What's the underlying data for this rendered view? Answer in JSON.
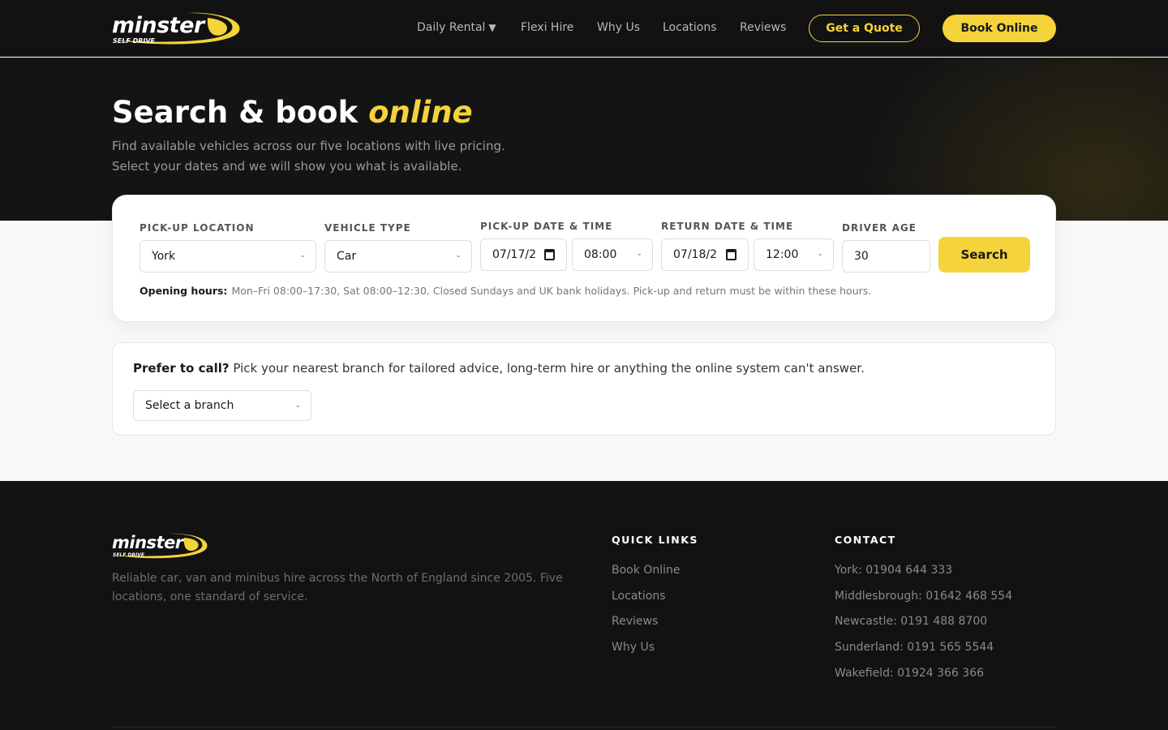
{
  "brand": {
    "logo_word": "minster",
    "logo_sub": "SELF DRIVE",
    "accent_color": "#f5d33a"
  },
  "nav": {
    "items": [
      {
        "label": "Daily Rental",
        "caret": "▼"
      },
      {
        "label": "Flexi Hire"
      },
      {
        "label": "Why Us"
      },
      {
        "label": "Locations"
      },
      {
        "label": "Reviews"
      }
    ],
    "quote_label": "Get a Quote",
    "book_label": "Book Online"
  },
  "hero": {
    "title": "Search & book",
    "title_accent": "online",
    "subtitle_line1": "Find available vehicles across our five locations with live pricing.",
    "subtitle_line2": "Select your dates and we will show you what is available."
  },
  "search": {
    "pickup_location_label": "PICK-UP LOCATION",
    "pickup_location_value": "York",
    "vehicle_type_label": "VEHICLE TYPE",
    "vehicle_type_value": "Car",
    "pickup_datetime_label": "PICK-UP DATE & TIME",
    "pickup_date_value": "07/17/2",
    "pickup_time_value": "08:00",
    "return_datetime_label": "RETURN DATE & TIME",
    "return_date_value": "07/18/2",
    "return_time_value": "12:00",
    "driver_age_label": "DRIVER AGE",
    "driver_age_value": "30",
    "search_label": "Search",
    "hours_label": "Opening hours:",
    "hours_text": "Mon–Fri 08:00–17:30, Sat 08:00–12:30. Closed Sundays and UK bank holidays. Pick-up and return must be within these hours."
  },
  "call": {
    "lead": "Prefer to call?",
    "text": "Pick your nearest branch for tailored advice, long-term hire or anything the online system can't answer.",
    "branch_placeholder": "Select a branch"
  },
  "footer": {
    "description": "Reliable car, van and minibus hire across the North of England since 2005. Five locations, one standard of service.",
    "quick_links_heading": "QUICK LINKS",
    "quick_links": [
      "Book Online",
      "Locations",
      "Reviews",
      "Why Us"
    ],
    "contact_heading": "CONTACT",
    "contacts": [
      "York: 01904 644 333",
      "Middlesbrough: 01642 468 554",
      "Newcastle: 0191 488 8700",
      "Sunderland: 0191 565 5544",
      "Wakefield: 01924 366 366"
    ]
  }
}
